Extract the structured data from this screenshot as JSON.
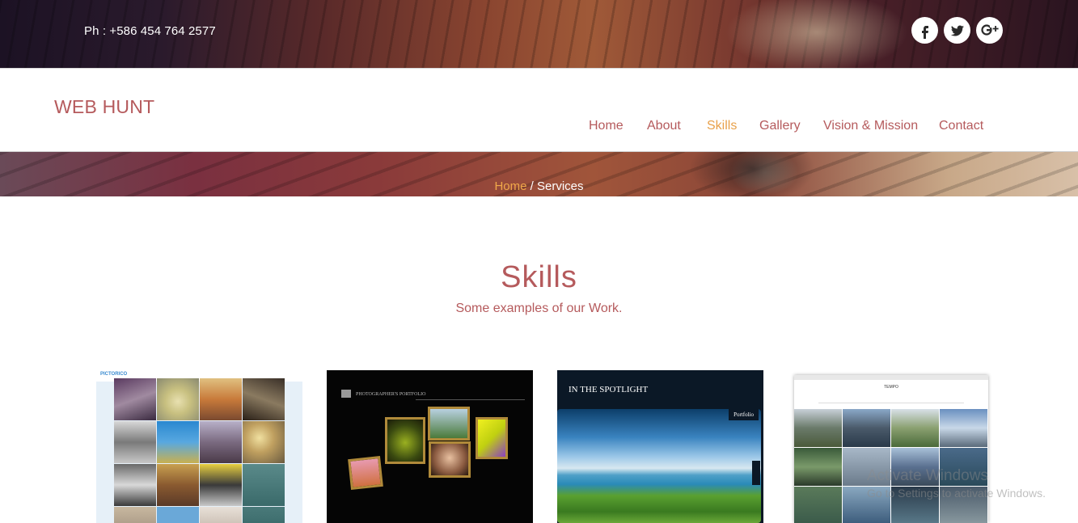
{
  "topbar": {
    "phone": "Ph : +586 454 764 2577",
    "social": [
      {
        "icon": "facebook-icon",
        "glyph": "f"
      },
      {
        "icon": "twitter-icon",
        "glyph": "t"
      },
      {
        "icon": "google-plus-icon",
        "glyph": "g+"
      }
    ]
  },
  "header": {
    "logo": "WEB HUNT",
    "nav": [
      "Home",
      "About",
      "Skills",
      "Gallery",
      "Vision & Mission",
      "Contact"
    ],
    "active": "Skills"
  },
  "breadcrumb": {
    "home": "Home",
    "separator": " / ",
    "current": "Services"
  },
  "section": {
    "title": "Skills",
    "subtitle": "Some examples of our Work."
  },
  "portfolio": {
    "items": [
      {
        "brand": "PICTORICO"
      },
      {
        "brand": "PHOTOGRAPHER'S PORTFOLIO"
      },
      {
        "brand": "IN THE SPOTLIGHT",
        "tag": "Portfolio"
      },
      {
        "brand": "TEMPO"
      }
    ]
  },
  "watermark": {
    "line1": "Activate Windows",
    "line2": "Go to Settings to activate Windows."
  },
  "colors": {
    "accent": "#b55a5c",
    "active": "#e8a14a",
    "crumb_home": "#f0a84a"
  }
}
